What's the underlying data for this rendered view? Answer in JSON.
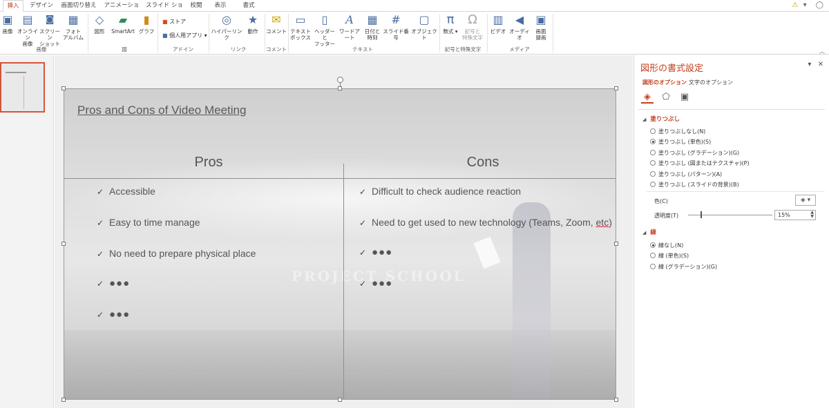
{
  "tabs": [
    {
      "label": "挿入",
      "active": true
    },
    {
      "label": "デザイン"
    },
    {
      "label": "画面切り替え"
    },
    {
      "label": "アニメーション"
    },
    {
      "label": "スライド ショー"
    },
    {
      "label": "校閲"
    },
    {
      "label": "表示"
    },
    {
      "label": "書式"
    }
  ],
  "ribbon": {
    "buttons": {
      "image": "画像",
      "online_image_1": "オンライン",
      "online_image_2": "画像",
      "screenshot_1": "スクリーン",
      "screenshot_2": "ショット",
      "album_1": "フォト",
      "album_2": "アルバム",
      "shapes": "図形",
      "smartart": "SmartArt",
      "graph": "グラフ",
      "store": "ストア",
      "personal_apps": "個人用アプリ",
      "hyperlink": "ハイパーリンク",
      "action": "動作",
      "comment": "コメント",
      "textbox_1": "テキスト",
      "textbox_2": "ボックス",
      "header_1": "ヘッダーと",
      "header_2": "フッター",
      "wordart": "ワードアート",
      "datetime_1": "日付と",
      "datetime_2": "時刻",
      "slide_number": "スライド番号",
      "object": "オブジェクト",
      "equation": "数式",
      "symbol_1": "記号と",
      "symbol_2": "特殊文字",
      "video": "ビデオ",
      "audio": "オーディオ",
      "screen_rec_1": "画面",
      "screen_rec_2": "録画"
    },
    "groups": {
      "images": "画像",
      "figures": "図",
      "addins": "アドイン",
      "links": "リンク",
      "comments": "コメント",
      "text": "テキスト",
      "symbols": "記号と特殊文字",
      "media": "メディア"
    }
  },
  "slide": {
    "title": "Pros and Cons of Video Meeting",
    "pros_header": "Pros",
    "cons_header": "Cons",
    "pros": [
      "Accessible",
      "Easy to time manage",
      "No need to prepare physical place",
      "●●●",
      "●●●"
    ],
    "cons_1": "Difficult to check audience reaction",
    "cons_2_pre": "Need to get used to new technology (Teams, Zoom, ",
    "cons_2_etc": "etc",
    "cons_2_post": ")",
    "cons_3": "●●●",
    "cons_4": "●●●",
    "watermark": "PROJECT SCHOOL"
  },
  "pane": {
    "title": "図形の書式設定",
    "tab_shape": "図形のオプション",
    "tab_text": "文字のオプション",
    "fill_section": "塗りつぶし",
    "fill_options": [
      {
        "label": "塗りつぶしなし(N)",
        "checked": false
      },
      {
        "label": "塗りつぶし (単色)(S)",
        "checked": true
      },
      {
        "label": "塗りつぶし (グラデーション)(G)",
        "checked": false
      },
      {
        "label": "塗りつぶし (図またはテクスチャ)(P)",
        "checked": false
      },
      {
        "label": "塗りつぶし (パターン)(A)",
        "checked": false
      },
      {
        "label": "塗りつぶし (スライドの背景)(B)",
        "checked": false
      }
    ],
    "color_label": "色(C)",
    "transparency_label": "透明度(T)",
    "transparency_value": "15%",
    "transparency_fraction": 0.15,
    "line_section": "線",
    "line_options": [
      {
        "label": "線なし(N)",
        "checked": true
      },
      {
        "label": "線 (単色)(S)",
        "checked": false
      },
      {
        "label": "線 (グラデーション)(G)",
        "checked": false
      }
    ]
  },
  "colors": {
    "accent": "#c43e1c",
    "thumb_border": "#d3543b"
  }
}
